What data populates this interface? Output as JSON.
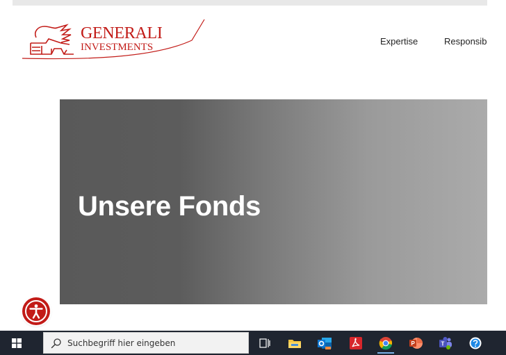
{
  "header": {
    "logo": {
      "line1": "GENERALI",
      "line2": "INVESTMENTS"
    },
    "nav": [
      {
        "label": "Expertise"
      },
      {
        "label": "Responsib"
      }
    ]
  },
  "hero": {
    "title": "Unsere Fonds"
  },
  "accessibility": {
    "icon": "accessibility-icon"
  },
  "taskbar": {
    "search_placeholder": "Suchbegriff hier eingeben",
    "apps": [
      {
        "name": "task-view-icon"
      },
      {
        "name": "file-explorer-icon"
      },
      {
        "name": "outlook-icon"
      },
      {
        "name": "acrobat-icon"
      },
      {
        "name": "chrome-icon",
        "active": true
      },
      {
        "name": "powerpoint-icon"
      },
      {
        "name": "teams-icon"
      },
      {
        "name": "help-icon"
      }
    ]
  },
  "colors": {
    "brand_red": "#c21b17",
    "taskbar": "#1f2530",
    "hero_dark": "#595959",
    "hero_light": "#ababab"
  }
}
